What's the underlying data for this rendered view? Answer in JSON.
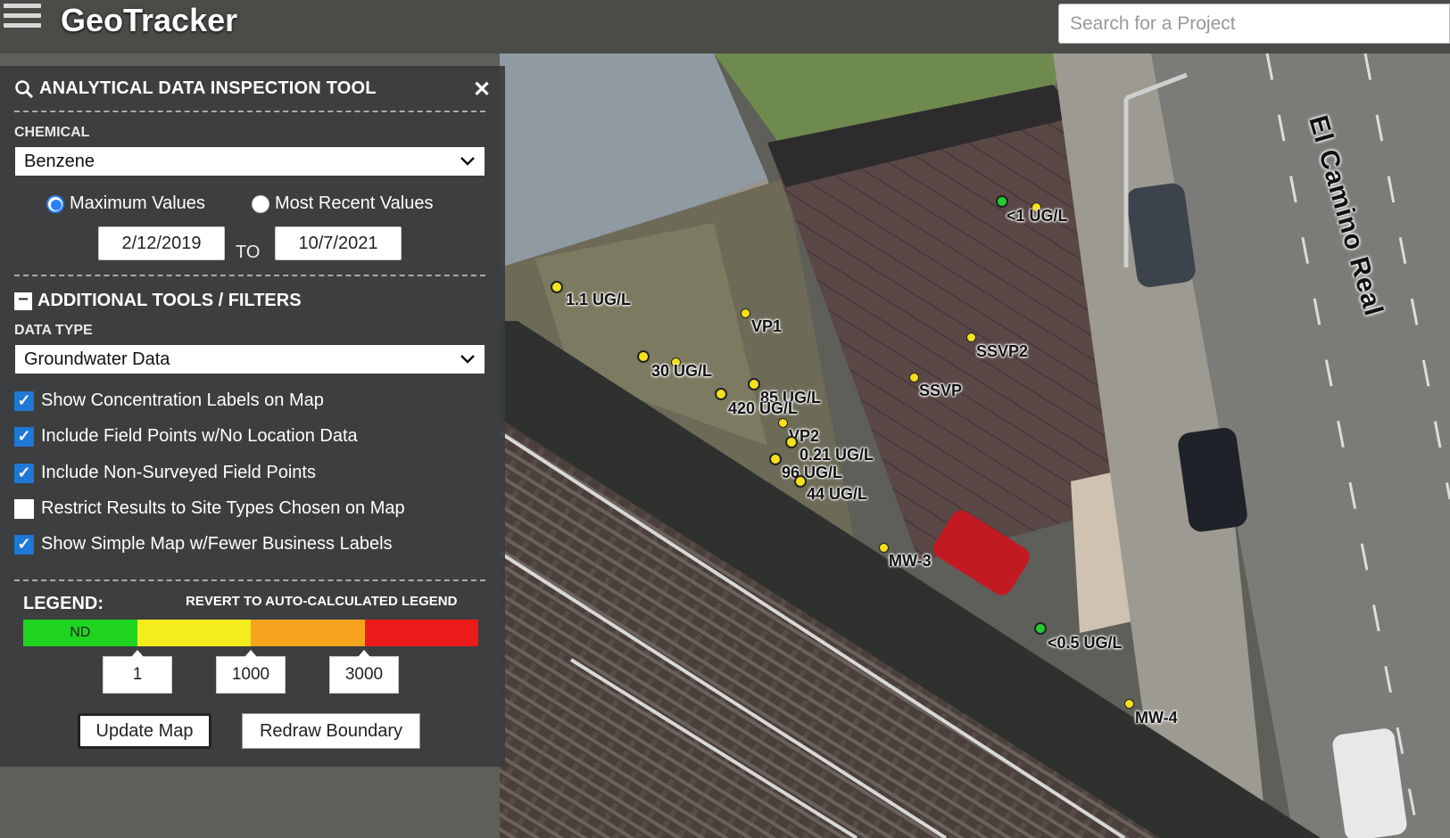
{
  "header": {
    "menu_icon": "hamburger-menu-icon",
    "title": "GeoTracker",
    "search_placeholder": "Search for a Project"
  },
  "panel": {
    "title": "ANALYTICAL DATA INSPECTION TOOL",
    "title_icon": "magnifier-icon",
    "close_icon": "close-icon",
    "close_glyph": "✕",
    "chemical": {
      "label": "CHEMICAL",
      "selected": "Benzene"
    },
    "value_mode": {
      "options": [
        "Maximum Values",
        "Most Recent Values"
      ],
      "selected": "Maximum Values"
    },
    "date_range": {
      "start": "2/12/2019",
      "separator": "TO",
      "end": "10/7/2021"
    },
    "additional_tools": {
      "title": "ADDITIONAL TOOLS / FILTERS",
      "collapse_glyph": "−"
    },
    "data_type": {
      "label": "DATA TYPE",
      "selected": "Groundwater Data"
    },
    "checkboxes": [
      {
        "label": "Show Concentration Labels on Map",
        "checked": true
      },
      {
        "label": "Include Field Points w/No Location Data",
        "checked": true
      },
      {
        "label": "Include Non-Surveyed Field Points",
        "checked": true
      },
      {
        "label": "Restrict Results to Site Types Chosen on Map",
        "checked": false
      },
      {
        "label": "Show Simple Map w/Fewer Business Labels",
        "checked": true
      }
    ],
    "legend": {
      "label": "LEGEND:",
      "revert_link": "REVERT TO AUTO-CALCULATED LEGEND",
      "bands": [
        {
          "label": "ND",
          "color": "#1fd41f"
        },
        {
          "label": "",
          "color": "#f4ec1c"
        },
        {
          "label": "",
          "color": "#f7a21d"
        },
        {
          "label": "",
          "color": "#ec1b1b"
        }
      ],
      "thresholds": [
        "1",
        "1000",
        "3000"
      ]
    },
    "buttons": {
      "update": "Update Map",
      "redraw": "Redraw Boundary"
    }
  },
  "map": {
    "road_label": "El Camino Real",
    "labels": [
      "<1 UG/L",
      "1.1 UG/L",
      "VP1",
      "SSVP2",
      "30 UG/L",
      "85 UG/L",
      "420 UG/L",
      "SSVP",
      "VP2",
      "0.21 UG/L",
      "96 UG/L",
      "44 UG/L",
      "MW-3",
      "<0.5 UG/L",
      "MW-4"
    ]
  }
}
